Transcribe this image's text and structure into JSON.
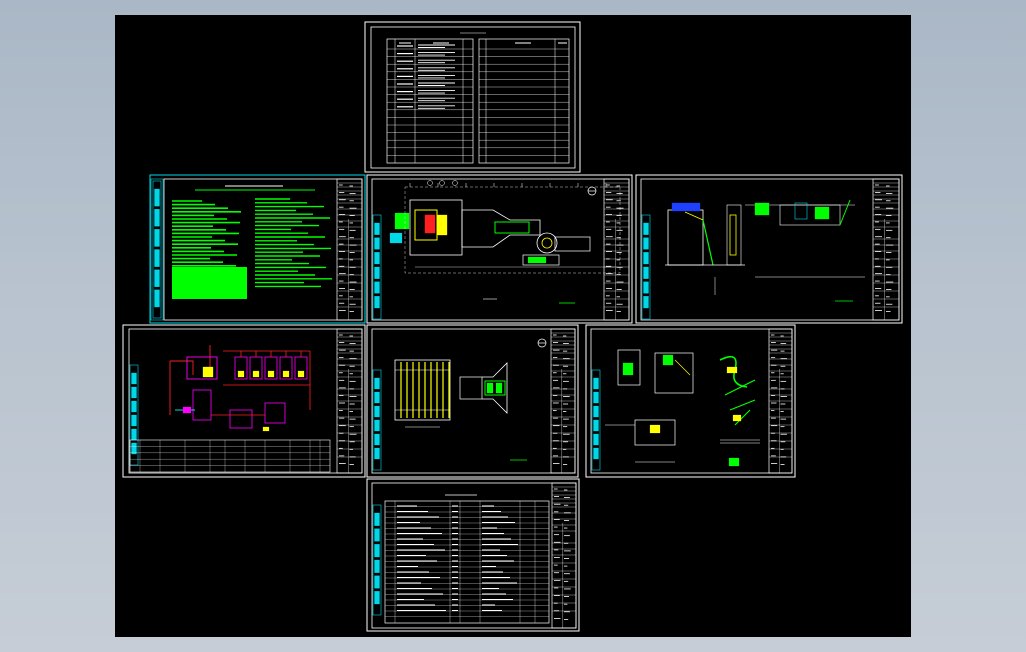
{
  "viewer": {
    "background_color": "#aab7c6",
    "canvas_color": "#000000"
  },
  "colors": {
    "white": "#ffffff",
    "cyan": "#00d8e8",
    "green": "#00ff00",
    "yellow": "#ffff00",
    "magenta": "#ff00ff",
    "red": "#ff2020",
    "blue": "#2040ff"
  },
  "sheets": [
    {
      "id": "drawing-index-sheet",
      "kind": "table"
    },
    {
      "id": "design-notes-sheet",
      "kind": "notes"
    },
    {
      "id": "site-plan-sheet",
      "kind": "plan"
    },
    {
      "id": "section-sheet",
      "kind": "section"
    },
    {
      "id": "process-flow-sheet",
      "kind": "schematic"
    },
    {
      "id": "tank-detail-sheet",
      "kind": "detail"
    },
    {
      "id": "equipment-detail-sheet",
      "kind": "detail"
    },
    {
      "id": "materials-list-sheet",
      "kind": "table"
    }
  ]
}
